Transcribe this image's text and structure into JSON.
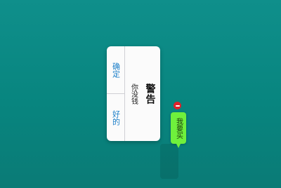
{
  "alert": {
    "title": "警告",
    "message": "你没钱",
    "buttons": [
      {
        "label": "确定"
      },
      {
        "label": "好的"
      }
    ]
  },
  "action_tag": {
    "label": "我要买",
    "color": "#6ff03c",
    "badge_color": "#e0202a",
    "badge_icon": "minus-icon"
  },
  "background_color": "#0a857f"
}
